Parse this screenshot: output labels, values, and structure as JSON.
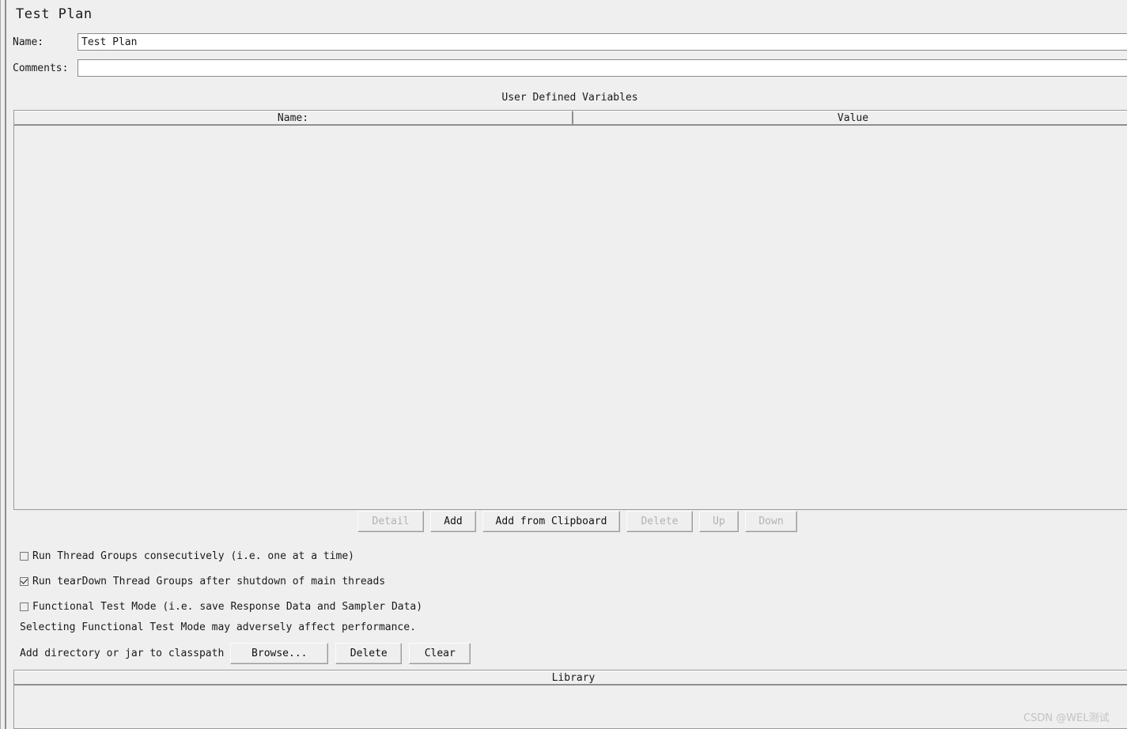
{
  "window": {
    "title": "Test Plan"
  },
  "form": {
    "name_label": "Name:",
    "name_value": "Test Plan",
    "name_placeholder": "",
    "comments_label": "Comments:",
    "comments_value": "",
    "comments_placeholder": ""
  },
  "variables": {
    "caption": "User Defined Variables",
    "columns": [
      "Name:",
      "Value"
    ],
    "rows": [],
    "buttons": [
      {
        "label": "Detail",
        "enabled": false
      },
      {
        "label": "Add",
        "enabled": true
      },
      {
        "label": "Add from Clipboard",
        "enabled": true
      },
      {
        "label": "Delete",
        "enabled": false
      },
      {
        "label": "Up",
        "enabled": false
      },
      {
        "label": "Down",
        "enabled": false
      }
    ]
  },
  "options": {
    "run_consecutively": {
      "label": "Run Thread Groups consecutively (i.e. one at a time)",
      "checked": false
    },
    "run_teardown": {
      "label": "Run tearDown Thread Groups after shutdown of main threads",
      "checked": true
    },
    "functional_mode": {
      "label": "Functional Test Mode (i.e. save Response Data and Sampler Data)",
      "checked": false
    },
    "functional_note": "Selecting Functional Test Mode may adversely affect performance."
  },
  "classpath": {
    "label": "Add directory or jar to classpath",
    "buttons": [
      {
        "label": "Browse...",
        "enabled": true
      },
      {
        "label": "Delete",
        "enabled": true
      },
      {
        "label": "Clear",
        "enabled": true
      }
    ],
    "table": {
      "columns": [
        "Library"
      ],
      "rows": []
    }
  },
  "watermark": {
    "text": "CSDN @WEL测试"
  },
  "colors": {
    "background": "#efefef",
    "input_background": "#ffffff",
    "border": "#8f8f8f",
    "text": "#1a1a1a",
    "disabled_text": "#b2b2b2",
    "watermark": "#c3c3c3"
  }
}
